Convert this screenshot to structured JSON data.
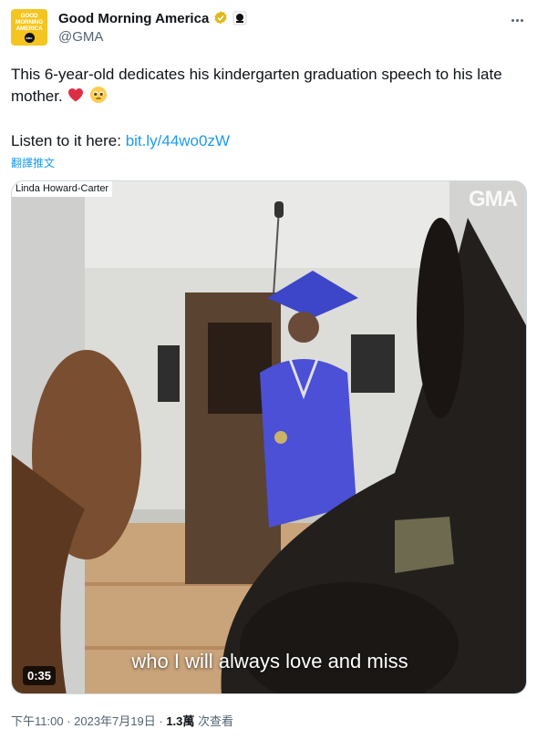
{
  "account": {
    "display_name": "Good Morning America",
    "handle": "@GMA",
    "avatar_lines": [
      "GOOD",
      "MORNING",
      "AMERICA"
    ],
    "avatar_badge": "abc",
    "brand_color": "#f5c51f",
    "verified_icon": "gold-checkmark-icon",
    "affiliate_icon": "affiliate-badge-icon"
  },
  "tweet": {
    "text": "This 6-year-old dedicates his kindergarten graduation speech to his late mother.",
    "emojis": [
      "red-heart-icon",
      "pleading-face-icon"
    ],
    "listen_prefix": "Listen to it here: ",
    "link_text": "bit.ly/44wo0zW",
    "translate_label": "翻譯推文",
    "link_color": "#1d9bf0"
  },
  "media": {
    "credit": "Linda Howard-Carter",
    "watermark": "GMA",
    "caption": "who I will always love and miss",
    "duration": "0:35"
  },
  "meta": {
    "time": "下午11:00",
    "separator": " · ",
    "date": "2023年7月19日",
    "views_count": "1.3萬",
    "views_label": " 次查看"
  }
}
